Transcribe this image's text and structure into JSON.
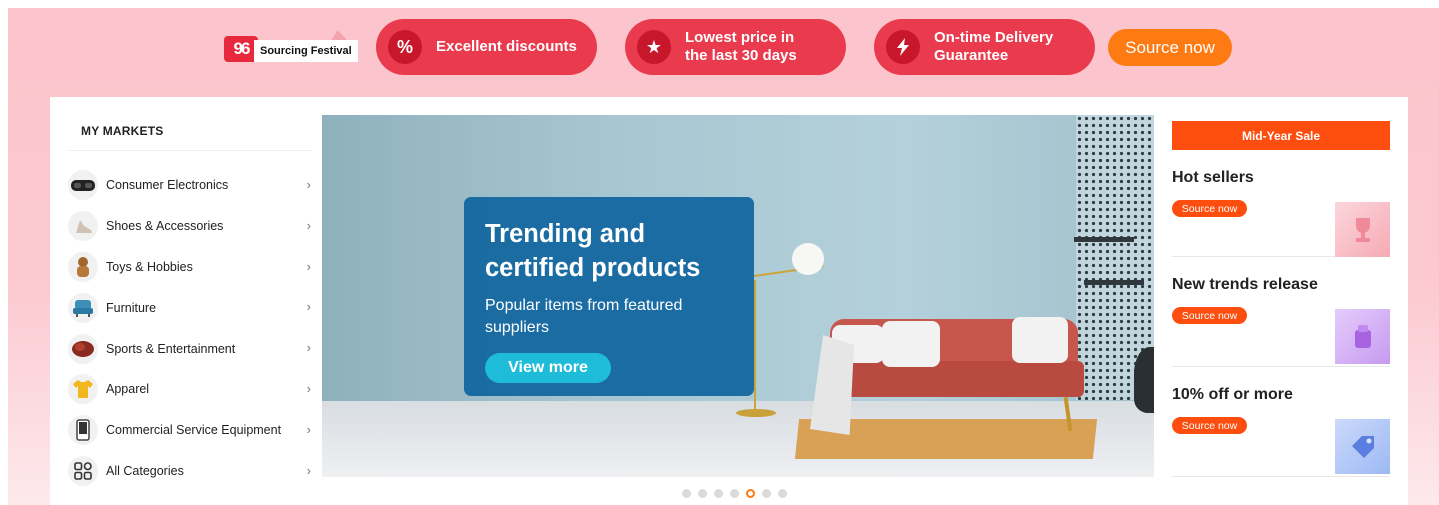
{
  "promo_bar": {
    "festival_logo": "96",
    "festival_label": "Sourcing Festival",
    "pills": [
      {
        "icon": "percent-icon",
        "label": "Excellent discounts"
      },
      {
        "icon": "star-icon",
        "label": "Lowest price in the last 30 days"
      },
      {
        "icon": "lightning-icon",
        "label": "On-time Delivery Guarantee"
      }
    ],
    "source_now_label": "Source now"
  },
  "sidebar": {
    "title": "MY MARKETS",
    "items": [
      {
        "icon": "headset-icon",
        "label": "Consumer Electronics"
      },
      {
        "icon": "shoe-icon",
        "label": "Shoes & Accessories"
      },
      {
        "icon": "toy-icon",
        "label": "Toys & Hobbies"
      },
      {
        "icon": "chair-icon",
        "label": "Furniture"
      },
      {
        "icon": "glove-icon",
        "label": "Sports & Entertainment"
      },
      {
        "icon": "shirt-icon",
        "label": "Apparel"
      },
      {
        "icon": "device-icon",
        "label": "Commercial Service Equipment"
      },
      {
        "icon": "grid-icon",
        "label": "All Categories"
      }
    ]
  },
  "banner": {
    "title": "Trending and certified products",
    "subtitle": "Popular items from featured suppliers",
    "cta_label": "View more",
    "slide_count": 7,
    "active_slide": 5
  },
  "right_panel": {
    "sale_label": "Mid-Year Sale",
    "blocks": [
      {
        "title": "Hot sellers",
        "button": "Source now",
        "thumb_icon": "trophy-icon"
      },
      {
        "title": "New trends release",
        "button": "Source now",
        "thumb_icon": "gift-box-icon"
      },
      {
        "title": "10% off or more",
        "button": "Source now",
        "thumb_icon": "discount-tag-icon"
      }
    ]
  },
  "colors": {
    "pill_red": "#ea3a4d",
    "source_orange": "#fe7a12",
    "sale_orange": "#fd4d0f",
    "banner_card_blue": "#10659e",
    "cta_cyan": "#1fbcd9",
    "page_pink": "#fcc4cc"
  }
}
